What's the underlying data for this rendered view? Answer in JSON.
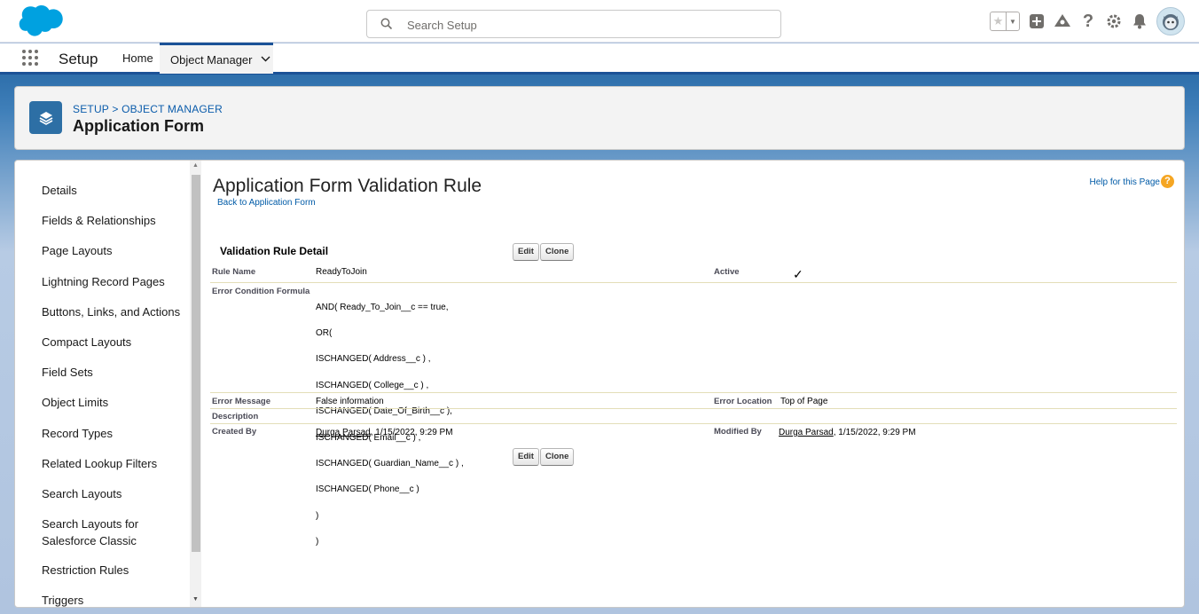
{
  "header": {
    "search_placeholder": "Search Setup"
  },
  "nav": {
    "app_name": "Setup",
    "tabs": [
      {
        "label": "Home"
      },
      {
        "label": "Object Manager"
      }
    ]
  },
  "object_header": {
    "breadcrumb": "SETUP > OBJECT MANAGER",
    "title": "Application Form"
  },
  "sidebar": {
    "items": [
      {
        "label": "Details"
      },
      {
        "label": "Fields & Relationships"
      },
      {
        "label": "Page Layouts"
      },
      {
        "label": "Lightning Record Pages"
      },
      {
        "label": "Buttons, Links, and Actions"
      },
      {
        "label": "Compact Layouts"
      },
      {
        "label": "Field Sets"
      },
      {
        "label": "Object Limits"
      },
      {
        "label": "Record Types"
      },
      {
        "label": "Related Lookup Filters"
      },
      {
        "label": "Search Layouts"
      },
      {
        "label": "Search Layouts for Salesforce Classic"
      },
      {
        "label": "Restriction Rules"
      },
      {
        "label": "Triggers"
      }
    ]
  },
  "content": {
    "page_title": "Application Form Validation Rule",
    "back_link": "Back to Application Form",
    "help_link": "Help for this Page",
    "section_title": "Validation Rule Detail",
    "buttons": {
      "edit": "Edit",
      "clone": "Clone"
    },
    "fields": {
      "rule_name_label": "Rule Name",
      "rule_name_value": "ReadyToJoin",
      "active_label": "Active",
      "active_value": "✓",
      "formula_label": "Error Condition Formula",
      "formula_lines": [
        "AND( Ready_To_Join__c == true,",
        "OR(",
        "ISCHANGED( Address__c ) ,",
        "ISCHANGED( College__c ) ,",
        "ISCHANGED( Date_Of_Birth__c ),",
        "ISCHANGED( Email__c ) ,",
        "ISCHANGED( Guardian_Name__c ) ,",
        "ISCHANGED( Phone__c )",
        ")",
        ")"
      ],
      "error_message_label": "Error Message",
      "error_message_value": "False information",
      "error_location_label": "Error Location",
      "error_location_value": "Top of Page",
      "description_label": "Description",
      "created_by_label": "Created By",
      "created_by_user": "Durga Parsad",
      "created_by_date": ", 1/15/2022, 9:29 PM",
      "modified_by_label": "Modified By",
      "modified_by_user": "Durga Parsad",
      "modified_by_date": ", 1/15/2022, 9:29 PM"
    }
  }
}
